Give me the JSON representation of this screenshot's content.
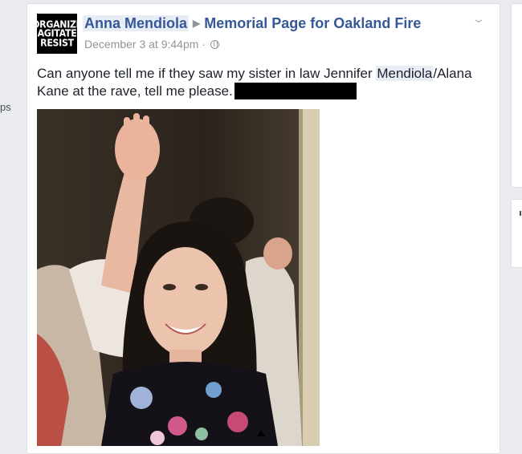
{
  "left_sidebar": {
    "fragment": "ps"
  },
  "post": {
    "avatar_lines": [
      "ORGANIZE",
      "AGITATE",
      "RESIST"
    ],
    "author": "Anna Mendiola",
    "target": "Memorial Page for Oakland Fire",
    "timestamp": "December 3 at 9:44pm",
    "separator": "·",
    "privacy_icon": "globe-icon",
    "text_before": "Can anyone tell me if they saw my sister in law Jennifer ",
    "text_highlight": "Mendiola",
    "text_after": "/Alana Kane at the rave, tell me please.",
    "photo_description_icon": "photo-image"
  },
  "colors": {
    "link": "#365899",
    "meta": "#90949c",
    "highlight": "#e7ecf5",
    "page_bg": "#e9ebee"
  }
}
